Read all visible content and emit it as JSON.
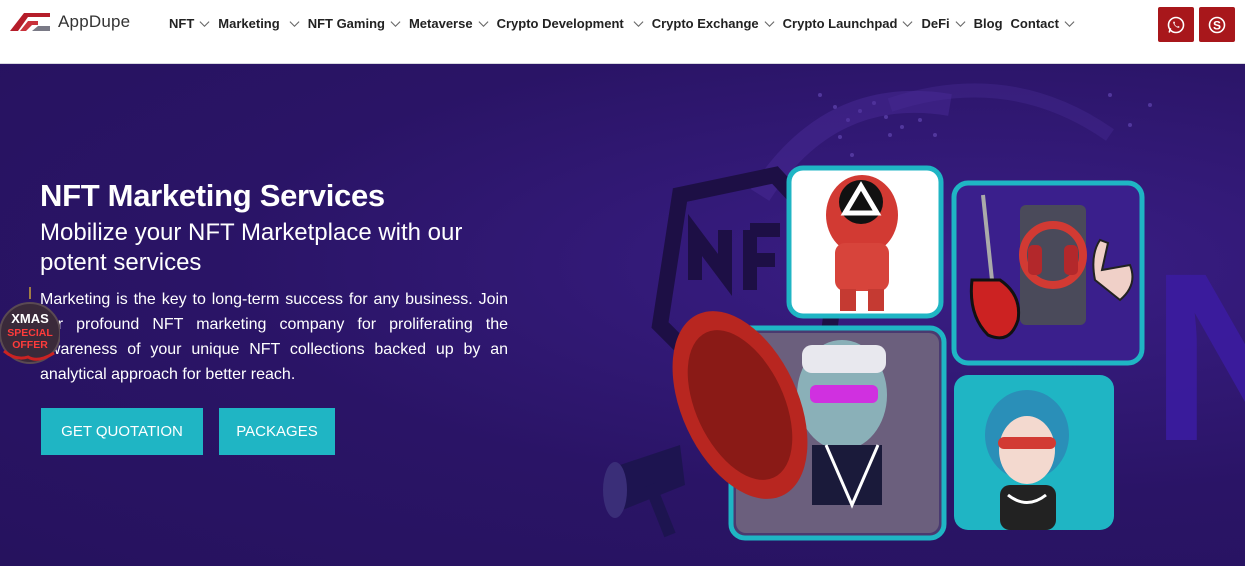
{
  "brand": {
    "name": "AppDupe"
  },
  "nav": {
    "items": [
      {
        "label": "NFT",
        "dropdown": true
      },
      {
        "label": "Marketing",
        "dropdown": true
      },
      {
        "label": "NFT Gaming",
        "dropdown": true
      },
      {
        "label": "Metaverse",
        "dropdown": true
      },
      {
        "label": "Crypto Development",
        "dropdown": true
      },
      {
        "label": "Crypto Exchange",
        "dropdown": true
      },
      {
        "label": "Crypto Launchpad",
        "dropdown": true
      },
      {
        "label": "DeFi",
        "dropdown": true
      },
      {
        "label": "Blog",
        "dropdown": false
      },
      {
        "label": "Contact",
        "dropdown": true
      }
    ]
  },
  "header_icons": {
    "whatsapp": "whatsapp-icon",
    "skype": "skype-icon"
  },
  "hero": {
    "title": "NFT Marketing Services",
    "subtitle": "Mobilize your NFT Marketplace with our potent services",
    "description": "Marketing is the key to long-term success for any business. Join our profound NFT marketing company for proliferating the awareness of your unique NFT collections backed up by an analytical approach for better reach.",
    "buttons": {
      "quote": "GET QUOTATION",
      "packages": "PACKAGES"
    },
    "badge": {
      "line1": "XMAS",
      "line2": "SPECIAL",
      "line3": "OFFER"
    },
    "art_text": "NFT"
  },
  "colors": {
    "hero_bg": "#2a1466",
    "accent": "#1fb5c4",
    "brand_red": "#a8171b"
  }
}
